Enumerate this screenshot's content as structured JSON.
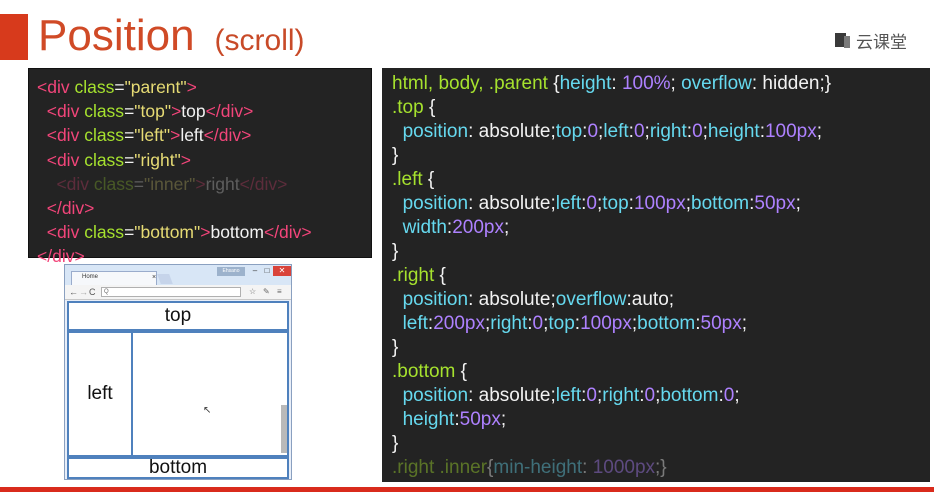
{
  "slide": {
    "title": "Position",
    "subtitle": "(scroll)",
    "logo_text": "云课堂"
  },
  "html_code": {
    "l1": {
      "t1": "<div ",
      "a1": "class",
      "p1": "=",
      "s1": "\"parent\"",
      "t2": ">"
    },
    "l2": {
      "t1": "<div ",
      "a1": "class",
      "p1": "=",
      "s1": "\"top\"",
      "t2": ">",
      "x": "top",
      "t3": "</div>"
    },
    "l3": {
      "t1": "<div ",
      "a1": "class",
      "p1": "=",
      "s1": "\"left\"",
      "t2": ">",
      "x": "left",
      "t3": "</div>"
    },
    "l4": {
      "t1": "<div ",
      "a1": "class",
      "p1": "=",
      "s1": "\"right\"",
      "t2": ">"
    },
    "l5": {
      "t1": "<div ",
      "a1": "class",
      "p1": "=",
      "s1": "\"inner\"",
      "t2": ">",
      "x": "right",
      "t3": "</div>"
    },
    "l6": {
      "t1": "</div>"
    },
    "l7": {
      "t1": "<div ",
      "a1": "class",
      "p1": "=",
      "s1": "\"bottom\"",
      "t2": ">",
      "x": "bottom",
      "t3": "</div>"
    },
    "l8": {
      "t1": "</div>"
    }
  },
  "css_code": {
    "l1": {
      "sel": "html, body, .parent ",
      "o": "{",
      "p1": "height",
      "c1": ": ",
      "v1": "100%",
      "sc1": "; ",
      "p2": "overflow",
      "c2": ": ",
      "v2": "hidden",
      "close": ";}"
    },
    "l2": {
      "sel": ".top ",
      "o": "{"
    },
    "l3": {
      "p1": "position",
      "c1": ": ",
      "v1": "absolute",
      "s1": ";",
      "p2": "top",
      "c2": ":",
      "n2": "0",
      "s2": ";",
      "p3": "left",
      "c3": ":",
      "n3": "0",
      "s3": ";",
      "p4": "right",
      "c4": ":",
      "n4": "0",
      "s4": ";",
      "p5": "height",
      "c5": ":",
      "n5": "100px",
      "s5": ";"
    },
    "l4": {
      "c": "}"
    },
    "l5": {
      "sel": ".left ",
      "o": "{"
    },
    "l6": {
      "p1": "position",
      "c1": ": ",
      "v1": "absolute",
      "s1": ";",
      "p2": "left",
      "c2": ":",
      "n2": "0",
      "s2": ";",
      "p3": "top",
      "c3": ":",
      "n3": "100px",
      "s3": ";",
      "p4": "bottom",
      "c4": ":",
      "n4": "50px",
      "s4": ";"
    },
    "l7": {
      "p1": "width",
      "c1": ":",
      "n1": "200px",
      "s1": ";"
    },
    "l8": {
      "c": "}"
    },
    "l9": {
      "sel": ".right ",
      "o": "{"
    },
    "l10": {
      "p1": "position",
      "c1": ": ",
      "v1": "absolute",
      "s1": ";",
      "p2": "overflow",
      "c2": ":",
      "v2": "auto",
      "s2": ";"
    },
    "l11": {
      "p1": "left",
      "c1": ":",
      "n1": "200px",
      "s1": ";",
      "p2": "right",
      "c2": ":",
      "n2": "0",
      "s2": ";",
      "p3": "top",
      "c3": ":",
      "n3": "100px",
      "s3": ";",
      "p4": "bottom",
      "c4": ":",
      "n4": "50px",
      "s4": ";"
    },
    "l12": {
      "c": "}"
    },
    "l13": {
      "sel": ".bottom ",
      "o": "{"
    },
    "l14": {
      "p1": "position",
      "c1": ": ",
      "v1": "absolute",
      "s1": ";",
      "p2": "left",
      "c2": ":",
      "n2": "0",
      "s2": ";",
      "p3": "right",
      "c3": ":",
      "n3": "0",
      "s3": ";",
      "p4": "bottom",
      "c4": ":",
      "n4": "0",
      "s4": ";"
    },
    "l15": {
      "p1": "height",
      "c1": ":",
      "n1": "50px",
      "s1": ";"
    },
    "l16": {
      "c": "}"
    },
    "l17": {
      "sel": ".right .inner",
      "o": "{",
      "p1": "min-height",
      "c1": ": ",
      "n1": "1000px",
      "close": ";}"
    }
  },
  "browser": {
    "tab_title": "Home",
    "tab_close": "×",
    "user_name": "Ehsano",
    "win_min": "–",
    "win_max": "□",
    "win_close": "✕",
    "nav_back": "←",
    "nav_forward": "→",
    "nav_reload": "C",
    "url_text": "Q",
    "star_icon": "☆",
    "tools_icon": "✎",
    "menu_icon": "≡",
    "cursor": "↖",
    "boxes": {
      "top": "top",
      "left": "left",
      "bottom": "bottom"
    }
  },
  "colors": {
    "accent": "#d73a1c",
    "code_bg": "#232323",
    "tag": "#f2457a",
    "attr": "#a6e22e",
    "string": "#e6db74",
    "property": "#66d9ef",
    "number": "#ae81ff",
    "box_border": "#4f81bd"
  }
}
